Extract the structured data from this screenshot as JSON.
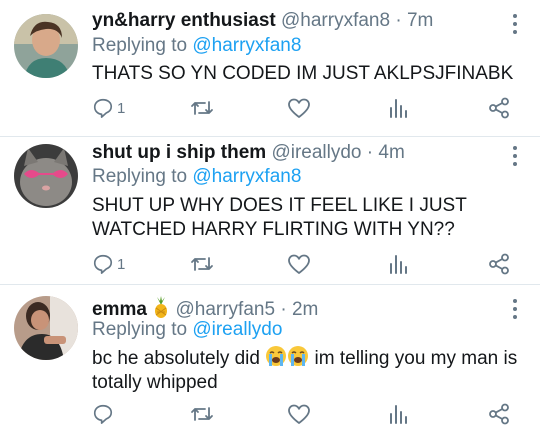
{
  "tweets": [
    {
      "display_name": "yn&harry enthusiast",
      "handle": "@harryxfan8",
      "dot": "·",
      "time": "7m",
      "replying_text": "Replying to",
      "replying_handle": "@harryxfan8",
      "body": "THATS SO YN CODED IM JUST AKLPSJFINABK",
      "reply_count": "1",
      "icons": [
        "reply-icon",
        "retweet-icon",
        "heart-icon",
        "analytics-icon",
        "share-icon"
      ]
    },
    {
      "display_name": "shut up i ship them",
      "handle": "@ireallydo",
      "dot": "·",
      "time": "4m",
      "replying_text": "Replying to",
      "replying_handle": "@harryxfan8",
      "body": "SHUT UP WHY DOES IT FEEL LIKE I JUST WATCHED HARRY FLIRTING WITH YN??",
      "reply_count": "1",
      "icons": [
        "reply-icon",
        "retweet-icon",
        "heart-icon",
        "analytics-icon",
        "share-icon"
      ]
    },
    {
      "display_name": "emma",
      "name_emoji": "pineapple-emoji",
      "handle": "@harryfan5",
      "dot": "·",
      "time": "2m",
      "replying_text": "Replying to",
      "replying_handle": "@ireallydo",
      "body_part1": "bc he absolutely did",
      "body_emojis": [
        "crying-face-emoji",
        "crying-face-emoji"
      ],
      "body_part2": "im telling you my man is totally whipped",
      "reply_count": "",
      "icons": [
        "reply-icon",
        "retweet-icon",
        "heart-icon",
        "analytics-icon",
        "share-icon"
      ]
    }
  ],
  "colors": {
    "text": "#14171a",
    "secondary": "#657786",
    "link": "#1da1f2",
    "divider": "#e1e8ed"
  }
}
